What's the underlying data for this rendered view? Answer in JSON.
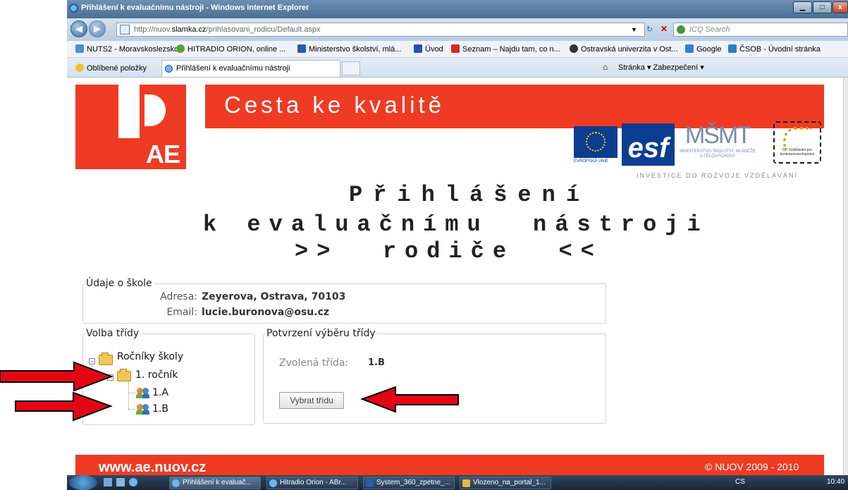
{
  "browser": {
    "window_title": "Přihlášení k evaluačnímu nástroji - Windows Internet Explorer",
    "url_prefix": "http://nuov.",
    "url_domain": "slamka.cz",
    "url_path": "/prihlasovani_rodicu/Default.aspx",
    "search_placeholder": "ICQ Search",
    "favorites_label": "Oblíbené položky",
    "favorites": [
      "NUTS2 - Moravskoslezsko",
      "HITRADIO ORION, online ...",
      "Ministerstvo školství, mlá...",
      "Úvod",
      "Seznam – Najdu tam, co n...",
      "Ostravská univerzita v Ost...",
      "Google",
      "ČSOB - Úvodní stránka"
    ],
    "tab_label": "Přihlášení k evaluačnímu nástroji",
    "command_bar": "Stránka ▾   Zabezpečení ▾"
  },
  "banner": {
    "slogan": "Cesta ke kvalitě",
    "logo_text": "AE",
    "eu_caption": "EVROPSKÁ UNIE",
    "esf_text": "esf",
    "msmt_text": "MŠMT",
    "msmt_caption": "MINISTERSTVO ŠKOLSTVÍ, MLÁDEŽE A TĚLOVÝCHOVY",
    "op_caption": "OP Vzdělávání pro konkurenceschopnost",
    "investice": "INVESTICE DO ROZVOJE VZDĚLÁVÁNÍ"
  },
  "heading": {
    "line1": "Přihlášení",
    "line2": "k evaluačnímu  nástroji",
    "line3": ">>  rodiče  <<"
  },
  "school": {
    "legend": "Údaje o škole",
    "address_label": "Adresa:",
    "address_value": "Zeyerova, Ostrava, 70103",
    "email_label": "Email:",
    "email_value": "lucie.buronova@osu.cz"
  },
  "class_select": {
    "legend": "Volba třídy",
    "tree": {
      "root": "Ročníky školy",
      "year": "1. ročník",
      "classes": [
        "1.A",
        "1.B"
      ]
    }
  },
  "confirm": {
    "legend": "Potvrzení výběru třídy",
    "selected_label": "Zvolená třída:",
    "selected_value": "1.B",
    "button": "Vybrat třídu"
  },
  "footer": {
    "url": "www.ae.nuov.cz",
    "copyright": "© NUOV 2009 - 2010"
  },
  "taskbar": {
    "items": [
      "Přihlášení k evaluač...",
      "Hitradio Orion - ABr...",
      "System_360_zpetne_...",
      "Vlozeno_na_portal_1..."
    ],
    "lang": "CS",
    "clock": "10:40"
  },
  "colors": {
    "brand_red": "#ef3b24",
    "arrow_red": "#e30613"
  }
}
